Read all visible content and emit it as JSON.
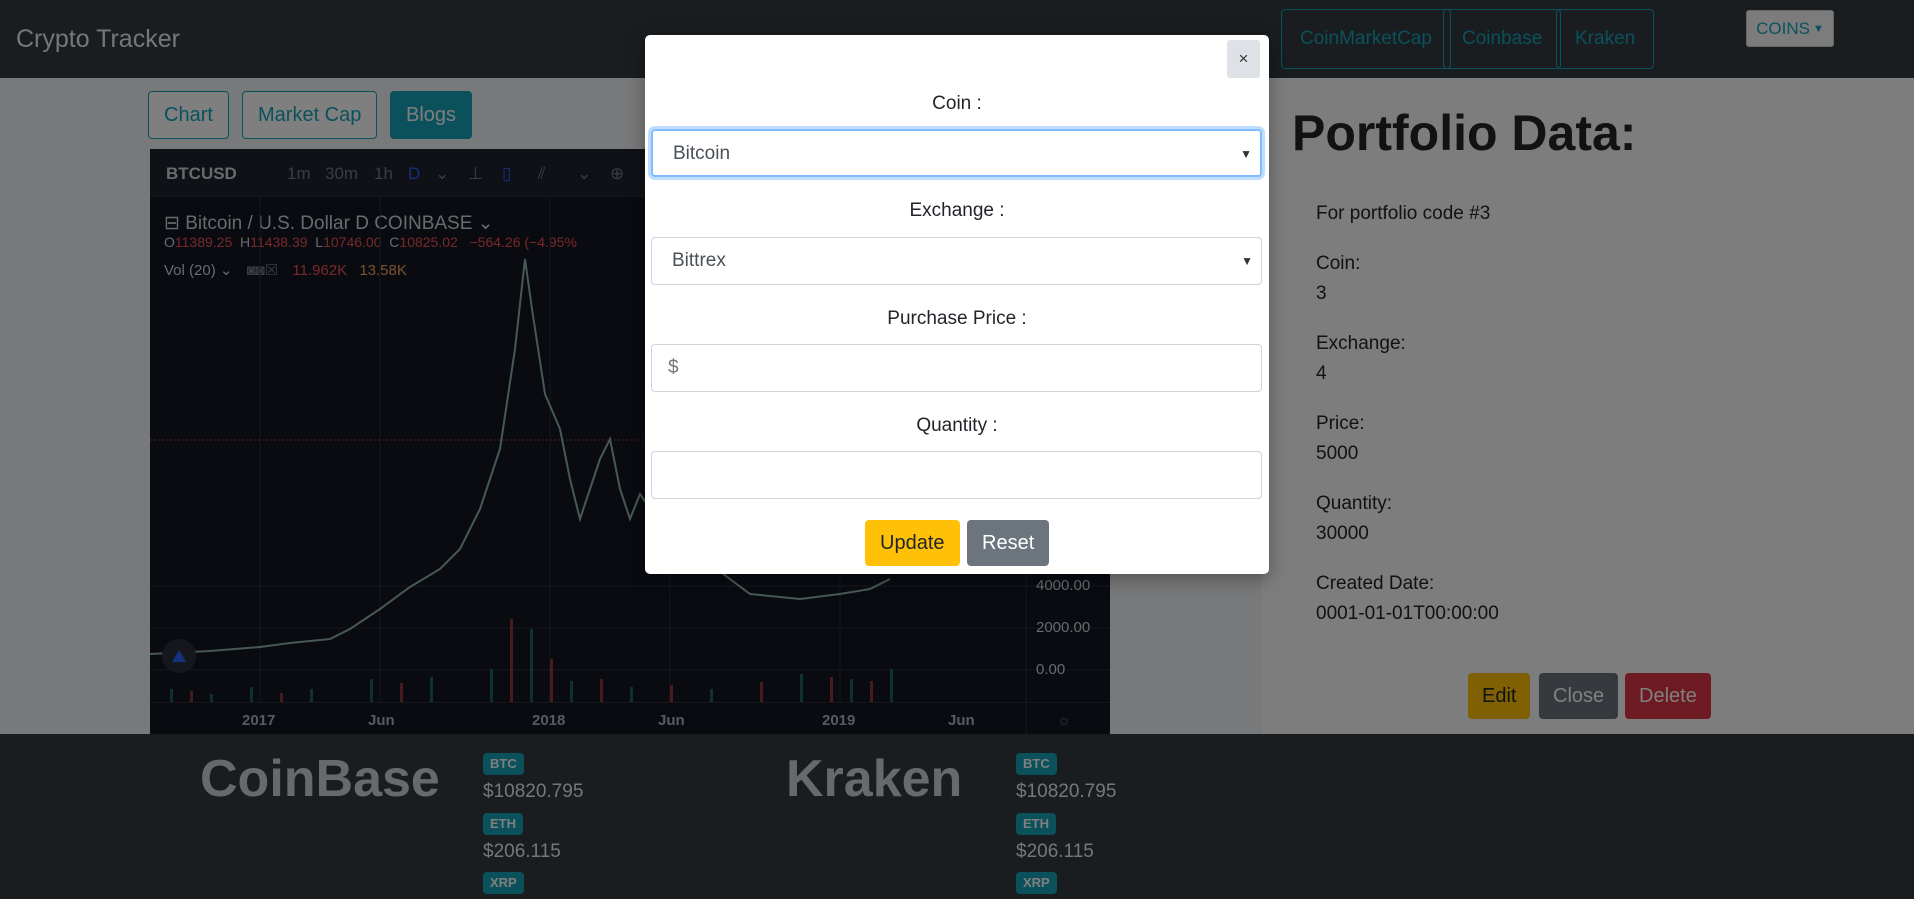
{
  "navbar": {
    "brand": "Crypto Tracker",
    "links": [
      "CoinMarketCap",
      "Coinbase",
      "Kraken"
    ],
    "coins_button": "COINS"
  },
  "tabs": [
    "Chart",
    "Market Cap",
    "Blogs"
  ],
  "chart_widget": {
    "symbol": "BTCUSD",
    "intervals": [
      "1m",
      "30m",
      "1h",
      "D"
    ],
    "legend": "Bitcoin / U.S. Dollar  D  COINBASE",
    "ohlc": {
      "o": "11389.25",
      "h": "11438.39",
      "l": "10746.00",
      "c": "10825.02",
      "change": "−564.26 (−4.95%"
    },
    "volume": {
      "label": "Vol (20)",
      "v1": "11.962K",
      "v2": "13.58K"
    },
    "x_labels": [
      "2017",
      "Jun",
      "2018",
      "Jun",
      "2019",
      "Jun"
    ],
    "y_labels": [
      "4000.00",
      "2000.00",
      "0.00"
    ]
  },
  "portfolio": {
    "title": "Portfolio Data:",
    "code_text": "For portfolio code #3",
    "coin_label": "Coin:",
    "coin_value": "3",
    "exchange_label": "Exchange:",
    "exchange_value": "4",
    "price_label": "Price:",
    "price_value": "5000",
    "quantity_label": "Quantity:",
    "quantity_value": "30000",
    "created_label": "Created Date:",
    "created_value": "0001-01-01T00:00:00",
    "edit": "Edit",
    "close": "Close",
    "delete": "Delete"
  },
  "bottom": {
    "exchanges": [
      {
        "name": "CoinBase",
        "coins": [
          {
            "sym": "BTC",
            "price": "$10820.795"
          },
          {
            "sym": "ETH",
            "price": "$206.115"
          },
          {
            "sym": "XRP",
            "price": ""
          }
        ]
      },
      {
        "name": "Kraken",
        "coins": [
          {
            "sym": "BTC",
            "price": "$10820.795"
          },
          {
            "sym": "ETH",
            "price": "$206.115"
          },
          {
            "sym": "XRP",
            "price": ""
          }
        ]
      }
    ]
  },
  "modal": {
    "close": "×",
    "coin_label": "Coin :",
    "coin_value": "Bitcoin",
    "exchange_label": "Exchange :",
    "exchange_value": "Bittrex",
    "price_label": "Purchase Price :",
    "price_placeholder": "$",
    "quantity_label": "Quantity :",
    "quantity_value": "",
    "update": "Update",
    "reset": "Reset"
  },
  "colors": {
    "accent": "#17a2b8",
    "warning": "#ffc107",
    "danger": "#dc3545",
    "secondary": "#6c757d"
  }
}
